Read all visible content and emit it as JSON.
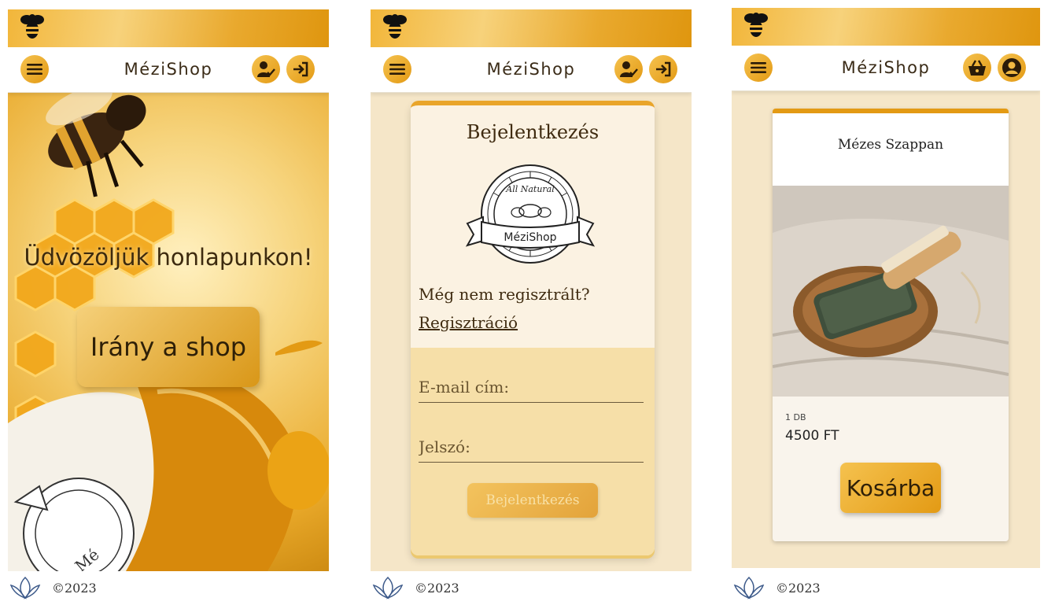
{
  "brand": "MéziShop",
  "footer": {
    "copyright": "©2023"
  },
  "home": {
    "welcome": "Üdvözöljük honlapunkon!",
    "shop_button": "Irány a shop",
    "seal_text": "Mé"
  },
  "login": {
    "title": "Bejelentkezés",
    "seal_top": "All Natural",
    "seal_brand": "MéziShop",
    "not_registered": "Még nem regisztrált?",
    "register_link": "Regisztráció",
    "email_placeholder": "E-mail cím:",
    "password_placeholder": "Jelszó:",
    "submit": "Bejelentkezés"
  },
  "product": {
    "name": "Mézes Szappan",
    "quantity": "1 DB",
    "price": "4500 FT",
    "add_to_cart": "Kosárba"
  },
  "colors": {
    "accent": "#e39a14",
    "cream": "#f5e6c8",
    "dark": "#3a2b17"
  },
  "icons": [
    "bee-icon",
    "menu-icon",
    "user-check-icon",
    "login-icon",
    "basket-icon",
    "account-icon",
    "lotus-logo"
  ]
}
